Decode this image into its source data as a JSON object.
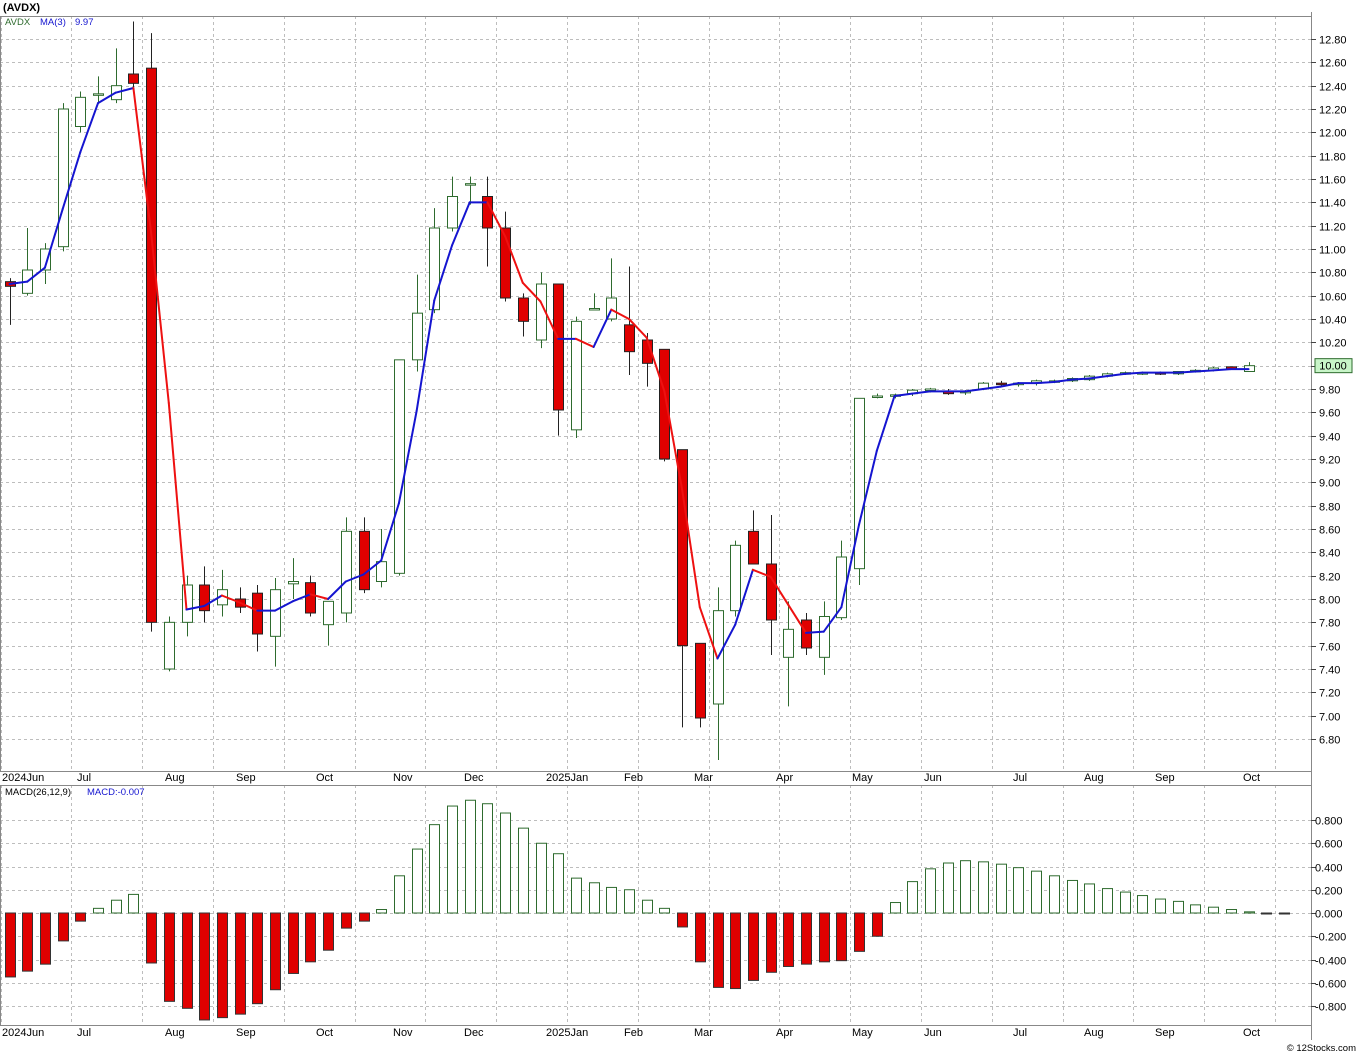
{
  "header": {
    "symbol_title": "(AVDX)",
    "credit": "© 12Stocks.com"
  },
  "legend": {
    "symbol": "AVDX",
    "ma_label": "MA(3)",
    "ma_value": "9.97",
    "macd_params": "MACD(26,12,9)",
    "macd_value": "MACD:-0.007"
  },
  "last_price_label": "10.00",
  "colors": {
    "up": "#2e6b2e",
    "down": "#e00000",
    "ma_up": "#1515d0",
    "ma_down": "#ee1111",
    "grid": "#bdbdbd",
    "last_price_bg": "#c8f5c8"
  },
  "x_axis_labels": [
    {
      "label": "2024Jun",
      "i": 0
    },
    {
      "label": "Jul",
      "i": 4.3
    },
    {
      "label": "Aug",
      "i": 9.3
    },
    {
      "label": "Sep",
      "i": 13.3
    },
    {
      "label": "Oct",
      "i": 17.8
    },
    {
      "label": "Nov",
      "i": 22.2
    },
    {
      "label": "Dec",
      "i": 26.2
    },
    {
      "label": "2025Jan",
      "i": 30.8
    },
    {
      "label": "Feb",
      "i": 35.2
    },
    {
      "label": "Mar",
      "i": 39.2
    },
    {
      "label": "Apr",
      "i": 43.8
    },
    {
      "label": "May",
      "i": 48.1
    },
    {
      "label": "Jun",
      "i": 52.2
    },
    {
      "label": "Jul",
      "i": 57.2
    },
    {
      "label": "Aug",
      "i": 61.2
    },
    {
      "label": "Sep",
      "i": 65.2
    },
    {
      "label": "Oct",
      "i": 70.2
    }
  ],
  "chart_data": [
    {
      "type": "candlestick",
      "title": "(AVDX)",
      "ylim": [
        6.62,
        13.05
      ],
      "yticks": [
        "6.80",
        "7.00",
        "7.20",
        "7.40",
        "7.60",
        "7.80",
        "8.00",
        "8.20",
        "8.40",
        "8.60",
        "8.80",
        "9.00",
        "9.20",
        "9.40",
        "9.60",
        "9.80",
        "10.00",
        "10.20",
        "10.40",
        "10.60",
        "10.80",
        "11.00",
        "11.20",
        "11.40",
        "11.60",
        "11.80",
        "12.00",
        "12.20",
        "12.40",
        "12.60",
        "12.80"
      ],
      "grid": true,
      "series": [
        {
          "name": "AVDX",
          "ohlc": [
            [
              10.72,
              10.75,
              10.35,
              10.68
            ],
            [
              10.62,
              11.18,
              10.6,
              10.82
            ],
            [
              10.82,
              11.05,
              10.7,
              11.0
            ],
            [
              11.02,
              12.25,
              10.98,
              12.2
            ],
            [
              12.05,
              12.35,
              12.0,
              12.3
            ],
            [
              12.33,
              12.48,
              12.25,
              12.33
            ],
            [
              12.28,
              12.72,
              12.25,
              12.4
            ],
            [
              12.5,
              12.95,
              12.38,
              12.42
            ],
            [
              12.55,
              12.85,
              7.72,
              7.8
            ],
            [
              7.4,
              7.85,
              7.38,
              7.8
            ],
            [
              7.8,
              8.2,
              7.68,
              8.12
            ],
            [
              8.12,
              8.28,
              7.8,
              7.9
            ],
            [
              7.95,
              8.25,
              7.85,
              8.08
            ],
            [
              8.0,
              8.1,
              7.88,
              7.93
            ],
            [
              8.05,
              8.12,
              7.55,
              7.7
            ],
            [
              7.68,
              8.18,
              7.42,
              8.08
            ],
            [
              8.13,
              8.35,
              8.0,
              8.15
            ],
            [
              8.14,
              8.2,
              7.85,
              7.88
            ],
            [
              7.78,
              7.98,
              7.6,
              7.98
            ],
            [
              7.88,
              8.7,
              7.8,
              8.58
            ],
            [
              8.58,
              8.7,
              8.05,
              8.08
            ],
            [
              8.15,
              8.6,
              8.1,
              8.32
            ],
            [
              8.22,
              10.05,
              8.2,
              10.05
            ],
            [
              10.05,
              10.78,
              9.95,
              10.45
            ],
            [
              10.48,
              11.35,
              10.45,
              11.18
            ],
            [
              11.18,
              11.62,
              11.15,
              11.45
            ],
            [
              11.55,
              11.62,
              11.38,
              11.56
            ],
            [
              11.45,
              11.62,
              10.85,
              11.18
            ],
            [
              11.18,
              11.32,
              10.55,
              10.58
            ],
            [
              10.58,
              10.62,
              10.25,
              10.38
            ],
            [
              10.22,
              10.8,
              10.15,
              10.7
            ],
            [
              10.7,
              10.7,
              9.4,
              9.62
            ],
            [
              9.45,
              10.42,
              9.38,
              10.38
            ],
            [
              10.48,
              10.62,
              10.48,
              10.49
            ],
            [
              10.4,
              10.92,
              10.38,
              10.58
            ],
            [
              10.35,
              10.85,
              9.92,
              10.12
            ],
            [
              10.22,
              10.28,
              9.82,
              10.02
            ],
            [
              10.14,
              10.14,
              9.18,
              9.2
            ],
            [
              9.28,
              9.28,
              6.9,
              7.6
            ],
            [
              7.62,
              7.62,
              6.9,
              6.98
            ],
            [
              7.1,
              8.1,
              6.62,
              7.9
            ],
            [
              7.9,
              8.5,
              7.85,
              8.46
            ],
            [
              8.58,
              8.76,
              8.3,
              8.3
            ],
            [
              8.3,
              8.72,
              7.52,
              7.82
            ],
            [
              7.5,
              7.98,
              7.08,
              7.74
            ],
            [
              7.82,
              7.88,
              7.52,
              7.58
            ],
            [
              7.5,
              7.98,
              7.35,
              7.85
            ],
            [
              7.84,
              8.5,
              7.82,
              8.36
            ],
            [
              8.26,
              9.72,
              8.12,
              9.72
            ],
            [
              9.74,
              9.76,
              9.72,
              9.74
            ],
            [
              9.74,
              9.76,
              9.72,
              9.75
            ],
            [
              9.76,
              9.8,
              9.74,
              9.79
            ],
            [
              9.79,
              9.81,
              9.77,
              9.8
            ],
            [
              9.78,
              9.8,
              9.75,
              9.76
            ],
            [
              9.77,
              9.79,
              9.75,
              9.78
            ],
            [
              9.8,
              9.86,
              9.79,
              9.85
            ],
            [
              9.85,
              9.87,
              9.83,
              9.84
            ],
            [
              9.84,
              9.86,
              9.82,
              9.85
            ],
            [
              9.85,
              9.88,
              9.83,
              9.87
            ],
            [
              9.87,
              9.88,
              9.85,
              9.87
            ],
            [
              9.87,
              9.9,
              9.86,
              9.89
            ],
            [
              9.88,
              9.92,
              9.87,
              9.91
            ],
            [
              9.91,
              9.94,
              9.9,
              9.93
            ],
            [
              9.93,
              9.95,
              9.92,
              9.94
            ],
            [
              9.94,
              9.95,
              9.92,
              9.94
            ],
            [
              9.94,
              9.95,
              9.92,
              9.93
            ],
            [
              9.93,
              9.95,
              9.92,
              9.95
            ],
            [
              9.95,
              9.97,
              9.94,
              9.96
            ],
            [
              9.96,
              9.99,
              9.95,
              9.98
            ],
            [
              9.99,
              9.99,
              9.97,
              9.97
            ],
            [
              9.95,
              10.03,
              9.95,
              10.0
            ]
          ]
        },
        {
          "name": "MA(3)",
          "values": [
            10.7,
            10.72,
            10.84,
            11.34,
            11.83,
            12.25,
            12.34,
            12.38,
            11.14,
            9.68,
            7.91,
            7.94,
            8.03,
            7.97,
            7.9,
            7.9,
            7.98,
            8.04,
            8.0,
            8.15,
            8.21,
            8.33,
            8.82,
            9.61,
            10.56,
            11.03,
            11.4,
            11.4,
            11.11,
            10.71,
            10.55,
            10.23,
            10.23,
            10.16,
            10.48,
            10.4,
            10.24,
            9.78,
            8.94,
            7.93,
            7.49,
            7.78,
            8.25,
            8.19,
            7.95,
            7.71,
            7.72,
            7.93,
            8.64,
            9.27,
            9.74,
            9.76,
            9.78,
            9.78,
            9.78,
            9.8,
            9.82,
            9.85,
            9.85,
            9.86,
            9.88,
            9.89,
            9.91,
            9.93,
            9.94,
            9.94,
            9.94,
            9.95,
            9.96,
            9.97,
            9.97
          ]
        }
      ]
    },
    {
      "type": "bar",
      "title": "MACD(26,12,9)",
      "ylim": [
        -0.95,
        1.0
      ],
      "yticks": [
        "-0.800",
        "-0.600",
        "-0.400",
        "-0.200",
        "0.000",
        "0.200",
        "0.400",
        "0.600",
        "0.800"
      ],
      "grid": true,
      "series": [
        {
          "name": "MACD",
          "values": [
            -0.55,
            -0.5,
            -0.44,
            -0.24,
            -0.07,
            0.04,
            0.11,
            0.16,
            -0.43,
            -0.76,
            -0.82,
            -0.92,
            -0.9,
            -0.87,
            -0.78,
            -0.66,
            -0.52,
            -0.42,
            -0.32,
            -0.13,
            -0.07,
            0.03,
            0.32,
            0.55,
            0.76,
            0.92,
            0.97,
            0.94,
            0.86,
            0.73,
            0.6,
            0.51,
            0.3,
            0.26,
            0.22,
            0.2,
            0.11,
            0.04,
            -0.12,
            -0.42,
            -0.64,
            -0.65,
            -0.58,
            -0.51,
            -0.46,
            -0.44,
            -0.42,
            -0.41,
            -0.33,
            -0.2,
            0.09,
            0.27,
            0.38,
            0.43,
            0.45,
            0.44,
            0.42,
            0.39,
            0.36,
            0.32,
            0.28,
            0.25,
            0.21,
            0.18,
            0.15,
            0.12,
            0.1,
            0.07,
            0.05,
            0.03,
            0.01,
            -0.007,
            -0.007
          ]
        }
      ]
    }
  ]
}
